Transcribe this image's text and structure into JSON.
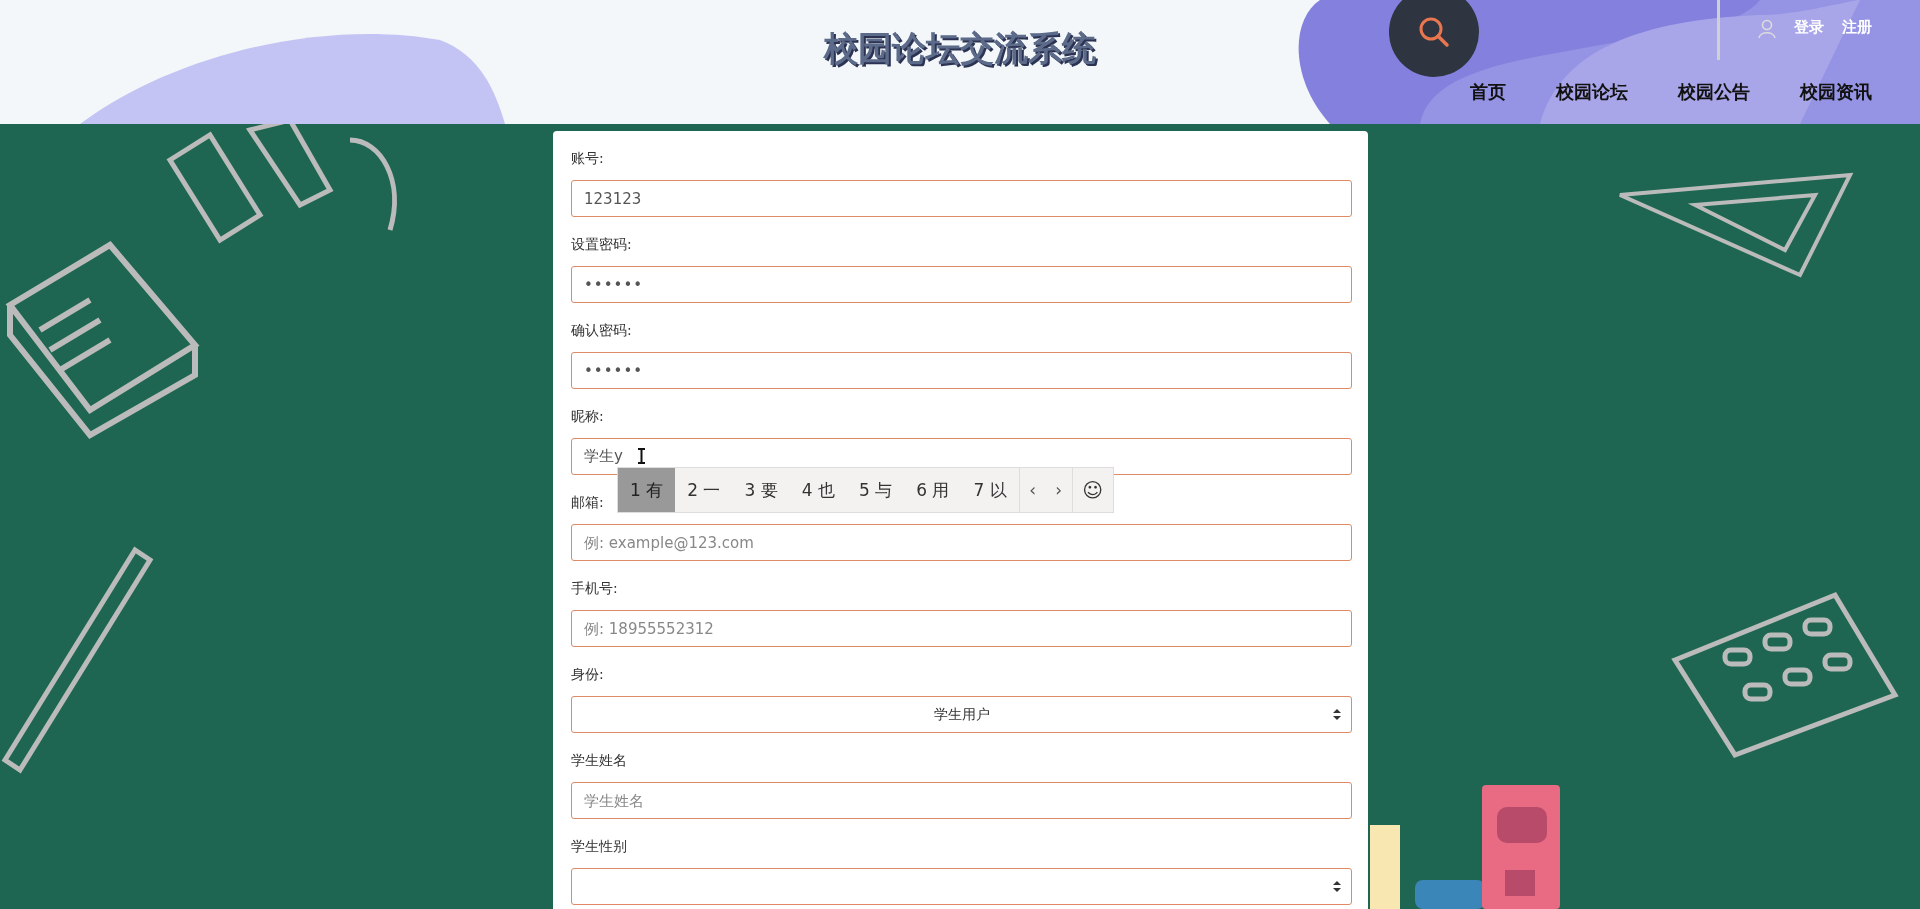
{
  "header": {
    "title": "校园论坛交流系统",
    "auth_links": [
      "登录",
      "注册"
    ],
    "nav": [
      "首页",
      "校园论坛",
      "校园公告",
      "校园资讯"
    ]
  },
  "form": {
    "fields": [
      {
        "label": "账号:",
        "kind": "text",
        "value": "123123"
      },
      {
        "label": "设置密码:",
        "kind": "password",
        "value": "••••••"
      },
      {
        "label": "确认密码:",
        "kind": "password",
        "value": "••••••"
      },
      {
        "label": "昵称:",
        "kind": "text",
        "value": "学生y"
      },
      {
        "label": "邮箱:",
        "kind": "text",
        "placeholder": "例: example@123.com"
      },
      {
        "label": "手机号:",
        "kind": "text",
        "placeholder": "例: 18955552312"
      },
      {
        "label": "身份:",
        "kind": "select",
        "value": "学生用户"
      },
      {
        "label": "学生姓名",
        "kind": "text",
        "placeholder": "学生姓名"
      },
      {
        "label": "学生性别",
        "kind": "select"
      }
    ]
  },
  "ime_candidates": {
    "candidates": [
      {
        "text": "1 有",
        "selected": true
      },
      {
        "text": "2 一",
        "selected": false
      },
      {
        "text": "3 要",
        "selected": false
      },
      {
        "text": "4 也",
        "selected": false
      },
      {
        "text": "5 与",
        "selected": false
      },
      {
        "text": "6 用",
        "selected": false
      },
      {
        "text": "7 以",
        "selected": false
      }
    ],
    "prev": "‹",
    "next": "›",
    "emoji": "☺"
  }
}
